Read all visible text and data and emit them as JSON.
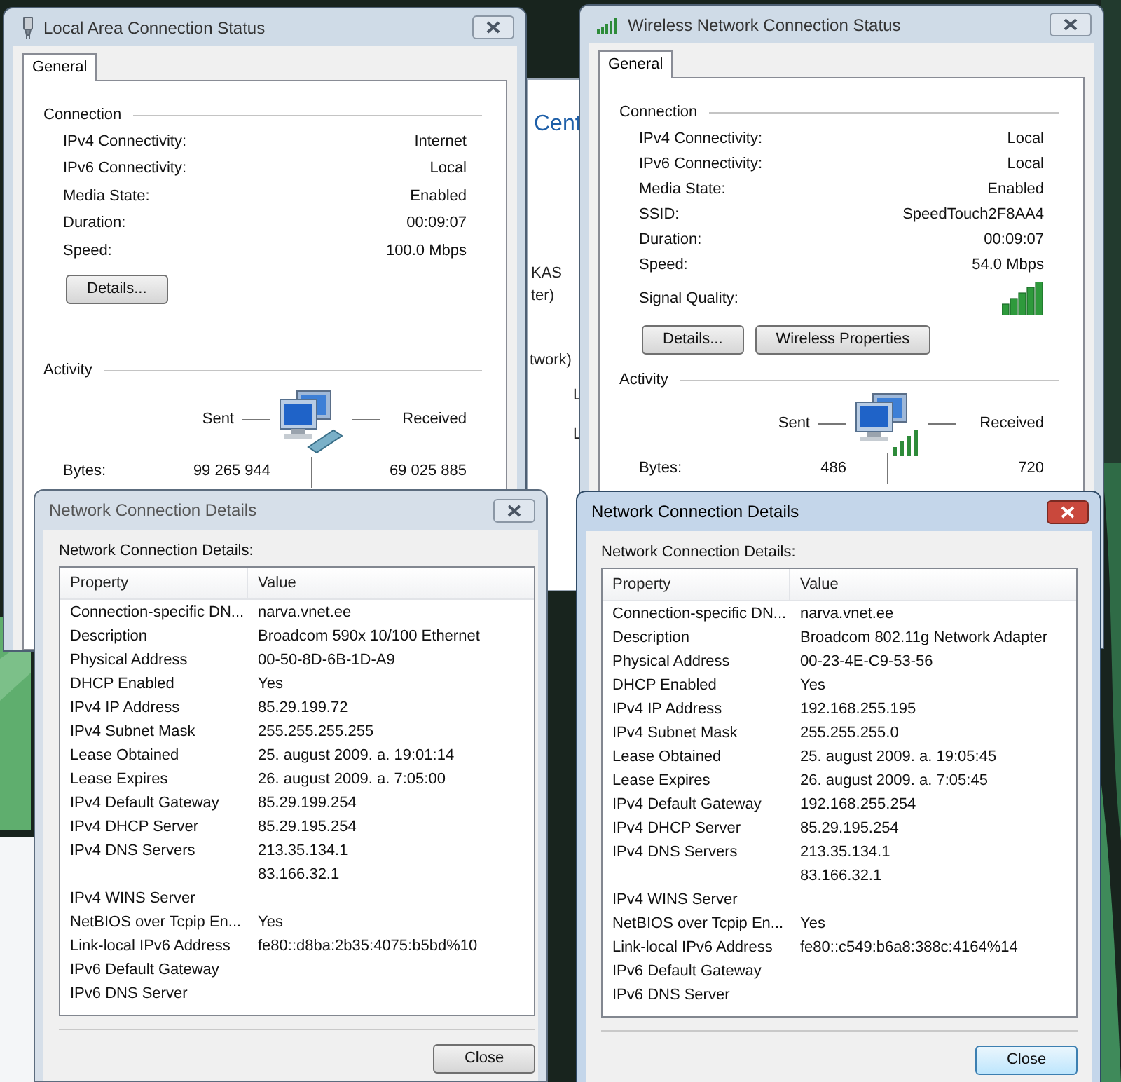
{
  "background_window": {
    "fragments": [
      {
        "text": "Cent",
        "kind": "heading"
      },
      {
        "text": "KAS",
        "kind": "text"
      },
      {
        "text": "ter)",
        "kind": "text"
      },
      {
        "text": "twork)",
        "kind": "text"
      },
      {
        "text": "L",
        "kind": "text"
      },
      {
        "text": "L",
        "kind": "text"
      }
    ]
  },
  "status_windows": [
    {
      "title": "Local Area Connection Status",
      "kind": "wired",
      "tabs": [
        {
          "label": "General",
          "selected": true
        }
      ],
      "connection_label": "Connection",
      "connection": [
        {
          "kind": "text",
          "label": "IPv4 Connectivity:",
          "value": "Internet"
        },
        {
          "kind": "text",
          "label": "IPv6 Connectivity:",
          "value": "Local"
        },
        {
          "kind": "text",
          "label": "Media State:",
          "value": "Enabled"
        },
        {
          "kind": "text",
          "label": "Duration:",
          "value": "00:09:07"
        },
        {
          "kind": "text",
          "label": "Speed:",
          "value": "100.0 Mbps"
        }
      ],
      "buttons": [
        "Details..."
      ],
      "activity_label": "Activity",
      "sent_label": "Sent",
      "received_label": "Received",
      "bytes_label": "Bytes:",
      "bytes_sent": "99 265 944",
      "bytes_received": "69 025 885"
    },
    {
      "title": "Wireless Network Connection Status",
      "kind": "wireless",
      "tabs": [
        {
          "label": "General",
          "selected": true
        }
      ],
      "connection_label": "Connection",
      "connection": [
        {
          "kind": "text",
          "label": "IPv4 Connectivity:",
          "value": "Local"
        },
        {
          "kind": "text",
          "label": "IPv6 Connectivity:",
          "value": "Local"
        },
        {
          "kind": "text",
          "label": "Media State:",
          "value": "Enabled"
        },
        {
          "kind": "text",
          "label": "SSID:",
          "value": "SpeedTouch2F8AA4"
        },
        {
          "kind": "text",
          "label": "Duration:",
          "value": "00:09:07"
        },
        {
          "kind": "text",
          "label": "Speed:",
          "value": "54.0 Mbps"
        },
        {
          "kind": "signal",
          "label": "Signal Quality:"
        }
      ],
      "buttons": [
        "Details...",
        "Wireless Properties"
      ],
      "activity_label": "Activity",
      "sent_label": "Sent",
      "received_label": "Received",
      "bytes_label": "Bytes:",
      "bytes_sent": "486",
      "bytes_received": "720"
    }
  ],
  "details_windows": [
    {
      "title": "Network Connection Details",
      "active": false,
      "caption": "Network Connection Details:",
      "columns": [
        "Property",
        "Value"
      ],
      "rows": [
        {
          "property": "Connection-specific DN...",
          "value": "narva.vnet.ee"
        },
        {
          "property": "Description",
          "value": "Broadcom 590x 10/100 Ethernet"
        },
        {
          "property": "Physical Address",
          "value": "00-50-8D-6B-1D-A9"
        },
        {
          "property": "DHCP Enabled",
          "value": "Yes"
        },
        {
          "property": "IPv4 IP Address",
          "value": "85.29.199.72"
        },
        {
          "property": "IPv4 Subnet Mask",
          "value": "255.255.255.255"
        },
        {
          "property": "Lease Obtained",
          "value": "25. august 2009. a. 19:01:14"
        },
        {
          "property": "Lease Expires",
          "value": "26. august 2009. a. 7:05:00"
        },
        {
          "property": "IPv4 Default Gateway",
          "value": "85.29.199.254"
        },
        {
          "property": "IPv4 DHCP Server",
          "value": "85.29.195.254"
        },
        {
          "property": "IPv4 DNS Servers",
          "value": "213.35.134.1"
        },
        {
          "value": "83.166.32.1"
        },
        {
          "property": "IPv4 WINS Server"
        },
        {
          "property": "NetBIOS over Tcpip En...",
          "value": "Yes"
        },
        {
          "property": "Link-local IPv6 Address",
          "value": "fe80::d8ba:2b35:4075:b5bd%10"
        },
        {
          "property": "IPv6 Default Gateway"
        },
        {
          "property": "IPv6 DNS Server"
        }
      ],
      "button": "Close"
    },
    {
      "title": "Network Connection Details",
      "active": true,
      "caption": "Network Connection Details:",
      "columns": [
        "Property",
        "Value"
      ],
      "rows": [
        {
          "property": "Connection-specific DN...",
          "value": "narva.vnet.ee"
        },
        {
          "property": "Description",
          "value": "Broadcom 802.11g Network Adapter"
        },
        {
          "property": "Physical Address",
          "value": "00-23-4E-C9-53-56"
        },
        {
          "property": "DHCP Enabled",
          "value": "Yes"
        },
        {
          "property": "IPv4 IP Address",
          "value": "192.168.255.195"
        },
        {
          "property": "IPv4 Subnet Mask",
          "value": "255.255.255.0"
        },
        {
          "property": "Lease Obtained",
          "value": "25. august 2009. a. 19:05:45"
        },
        {
          "property": "Lease Expires",
          "value": "26. august 2009. a. 7:05:45"
        },
        {
          "property": "IPv4 Default Gateway",
          "value": "192.168.255.254"
        },
        {
          "property": "IPv4 DHCP Server",
          "value": "85.29.195.254"
        },
        {
          "property": "IPv4 DNS Servers",
          "value": "213.35.134.1"
        },
        {
          "value": "83.166.32.1"
        },
        {
          "property": "IPv4 WINS Server"
        },
        {
          "property": "NetBIOS over Tcpip En...",
          "value": "Yes"
        },
        {
          "property": "Link-local IPv6 Address",
          "value": "fe80::c549:b6a8:388c:4164%14"
        },
        {
          "property": "IPv6 Default Gateway"
        },
        {
          "property": "IPv6 DNS Server"
        }
      ],
      "button": "Close"
    }
  ]
}
